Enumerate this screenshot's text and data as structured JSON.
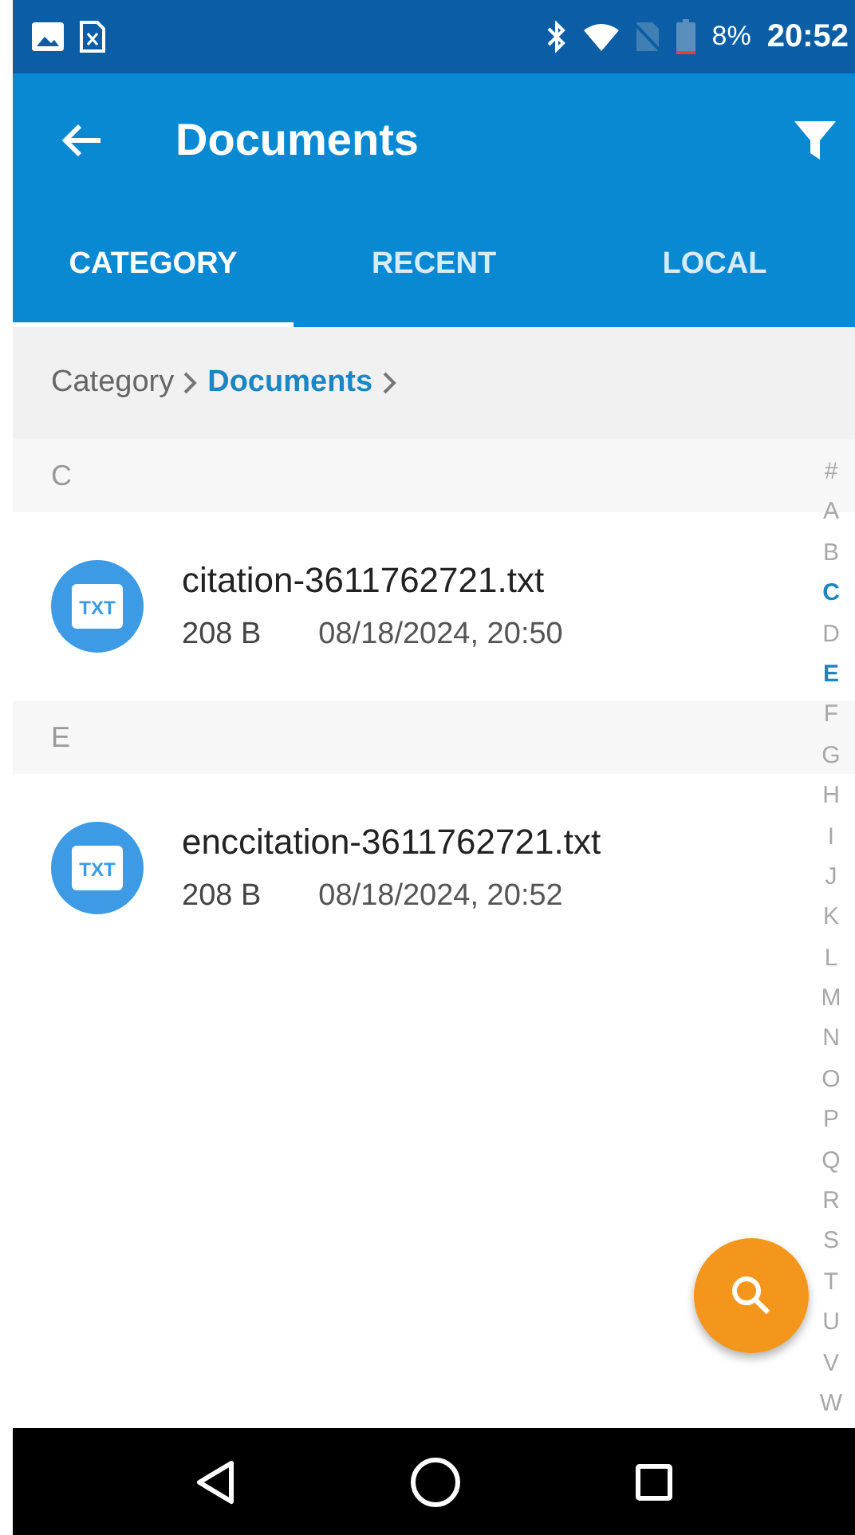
{
  "status_bar": {
    "battery": "8%",
    "time": "20:52"
  },
  "app_bar": {
    "title": "Documents"
  },
  "tabs": [
    {
      "label": "CATEGORY",
      "selected": true
    },
    {
      "label": "RECENT",
      "selected": false
    },
    {
      "label": "LOCAL",
      "selected": false
    }
  ],
  "breadcrumb": [
    {
      "label": "Category",
      "current": false
    },
    {
      "label": "Documents",
      "current": true
    }
  ],
  "sections": [
    {
      "letter": "C",
      "files": [
        {
          "icon": "TXT",
          "name": "citation-3611762721.txt",
          "size": "208 B",
          "modified": "08/18/2024, 20:50"
        }
      ]
    },
    {
      "letter": "E",
      "files": [
        {
          "icon": "TXT",
          "name": "enccitation-3611762721.txt",
          "size": "208 B",
          "modified": "08/18/2024, 20:52"
        }
      ]
    }
  ],
  "index_letters": [
    {
      "label": "#",
      "active": false
    },
    {
      "label": "A",
      "active": false
    },
    {
      "label": "B",
      "active": false
    },
    {
      "label": "C",
      "active": true
    },
    {
      "label": "D",
      "active": false
    },
    {
      "label": "E",
      "active": true
    },
    {
      "label": "F",
      "active": false
    },
    {
      "label": "G",
      "active": false
    },
    {
      "label": "H",
      "active": false
    },
    {
      "label": "I",
      "active": false
    },
    {
      "label": "J",
      "active": false
    },
    {
      "label": "K",
      "active": false
    },
    {
      "label": "L",
      "active": false
    },
    {
      "label": "M",
      "active": false
    },
    {
      "label": "N",
      "active": false
    },
    {
      "label": "O",
      "active": false
    },
    {
      "label": "P",
      "active": false
    },
    {
      "label": "Q",
      "active": false
    },
    {
      "label": "R",
      "active": false
    },
    {
      "label": "S",
      "active": false
    },
    {
      "label": "T",
      "active": false
    },
    {
      "label": "U",
      "active": false
    },
    {
      "label": "V",
      "active": false
    },
    {
      "label": "W",
      "active": false
    }
  ]
}
